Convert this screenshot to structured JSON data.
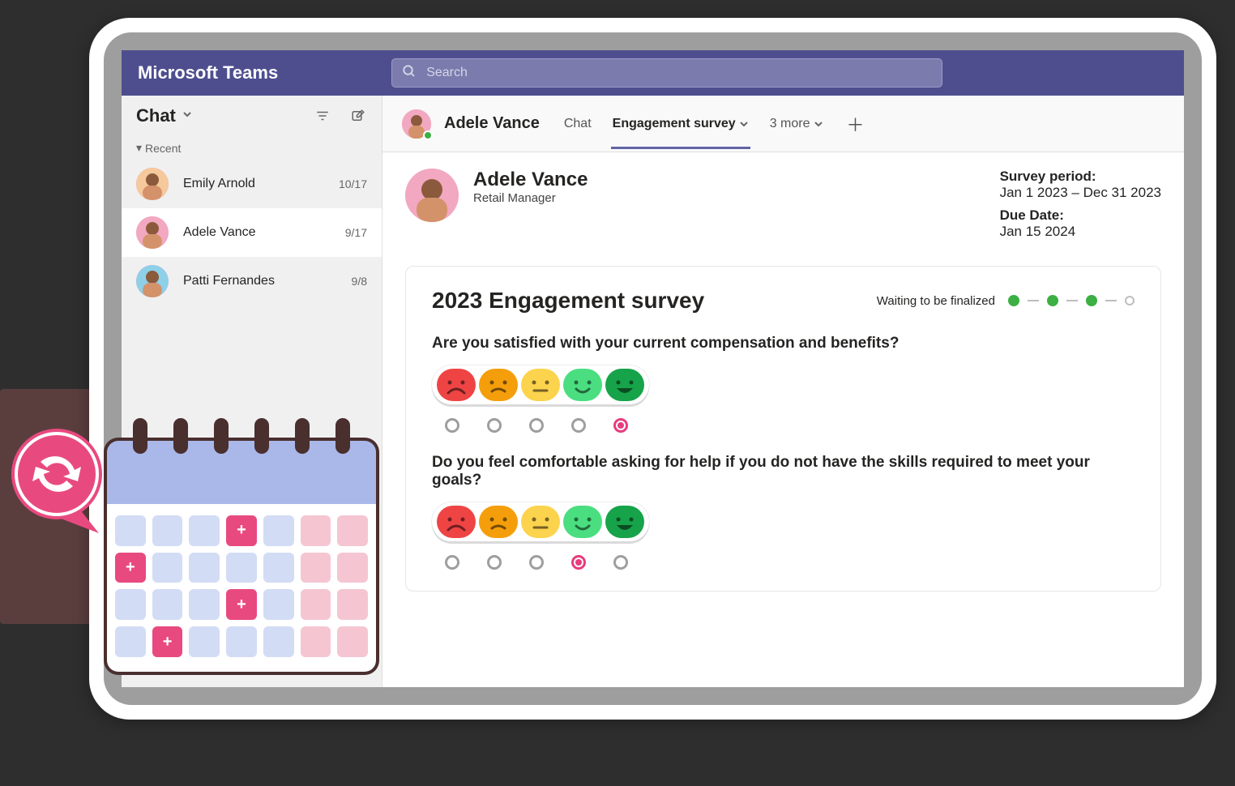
{
  "app_title": "Microsoft Teams",
  "search_placeholder": "Search",
  "sidebar": {
    "title": "Chat",
    "recent_label": "Recent",
    "items": [
      {
        "name": "Emily Arnold",
        "date": "10/17"
      },
      {
        "name": "Adele Vance",
        "date": "9/17"
      },
      {
        "name": "Patti Fernandes",
        "date": "9/8"
      }
    ],
    "active_index": 1
  },
  "header": {
    "name": "Adele Vance",
    "tabs": [
      {
        "label": "Chat",
        "active": false,
        "chevron": false
      },
      {
        "label": "Engagement survey",
        "active": true,
        "chevron": true
      },
      {
        "label": "3 more",
        "active": false,
        "chevron": true
      }
    ]
  },
  "profile": {
    "name": "Adele Vance",
    "role": "Retail Manager",
    "period_label": "Survey period:",
    "period_value": "Jan 1 2023 – Dec 31 2023",
    "due_label": "Due Date:",
    "due_value": "Jan 15 2024"
  },
  "survey": {
    "title": "2023 Engagement survey",
    "status_text": "Waiting to be finalized",
    "progress": [
      true,
      true,
      true,
      false
    ],
    "questions": [
      {
        "text": "Are you satisfied with your current compensation and benefits?",
        "selected": 4
      },
      {
        "text": "Do you feel comfortable asking for help if you do not have the skills required to meet your goals?",
        "selected": 3
      }
    ]
  },
  "calendar": {
    "cells": [
      "b",
      "b",
      "b",
      "h",
      "b",
      "p",
      "p",
      "h",
      "b",
      "b",
      "b",
      "b",
      "p",
      "p",
      "b",
      "b",
      "b",
      "h",
      "b",
      "p",
      "p",
      "b",
      "h",
      "b",
      "b",
      "b",
      "p",
      "p"
    ]
  }
}
